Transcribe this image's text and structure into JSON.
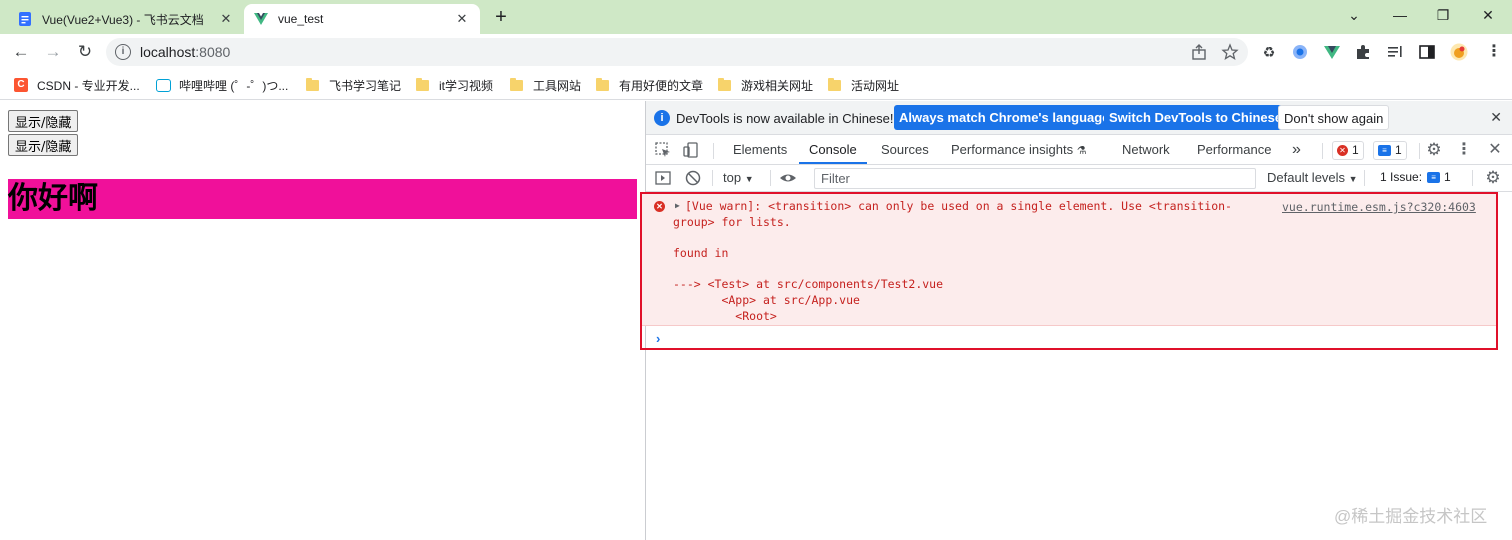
{
  "browser": {
    "tabs": [
      {
        "title": "Vue(Vue2+Vue3) - 飞书云文档",
        "close": "✕"
      },
      {
        "title": "vue_test",
        "close": "✕"
      }
    ],
    "new_tab": "+",
    "window_controls": {
      "collapse": "⌄",
      "minimize": "—",
      "restore": "❐",
      "close": "✕"
    },
    "nav": {
      "back": "←",
      "forward": "→",
      "reload": "↻"
    },
    "address": {
      "host": "localhost",
      "port": ":8080",
      "info": "i"
    },
    "bookmarks": [
      "CSDN - 专业开发...",
      "哔哩哔哩 (゜-゜)つ...",
      "飞书学习笔记",
      "it学习视频",
      "工具网站",
      "有用好便的文章",
      "游戏相关网址",
      "活动网址"
    ]
  },
  "page": {
    "buttons": [
      "显示/隐藏",
      "显示/隐藏"
    ],
    "hello_text": "你好啊",
    "hello_bg": "#f0109a"
  },
  "devtools": {
    "infobar": {
      "message": "DevTools is now available in Chinese!",
      "btn_match": "Always match Chrome's language",
      "btn_switch": "Switch DevTools to Chinese",
      "btn_dismiss": "Don't show again",
      "close": "✕"
    },
    "tabs": [
      "Elements",
      "Console",
      "Sources",
      "Performance insights",
      "Network",
      "Performance"
    ],
    "more_tabs": "»",
    "error_count": "1",
    "message_count": "1",
    "filterbar": {
      "context": "top",
      "filter_placeholder": "Filter",
      "levels": "Default levels",
      "issues": "1 Issue:",
      "issues_count": "1"
    },
    "console": {
      "warn_lines": [
        "[Vue warn]: <transition> can only be used on a single element. Use <transition-",
        "group> for lists.",
        "",
        "found in",
        "",
        "---> <Test> at src/components/Test2.vue",
        "       <App> at src/App.vue",
        "         <Root>"
      ],
      "source": "vue.runtime.esm.js?c320:4603",
      "prompt": "›"
    },
    "accent": "#1a73e8",
    "error_color": "#d93025",
    "highlight_border": "#e0102a"
  },
  "watermark": "@稀土掘金技术社区"
}
